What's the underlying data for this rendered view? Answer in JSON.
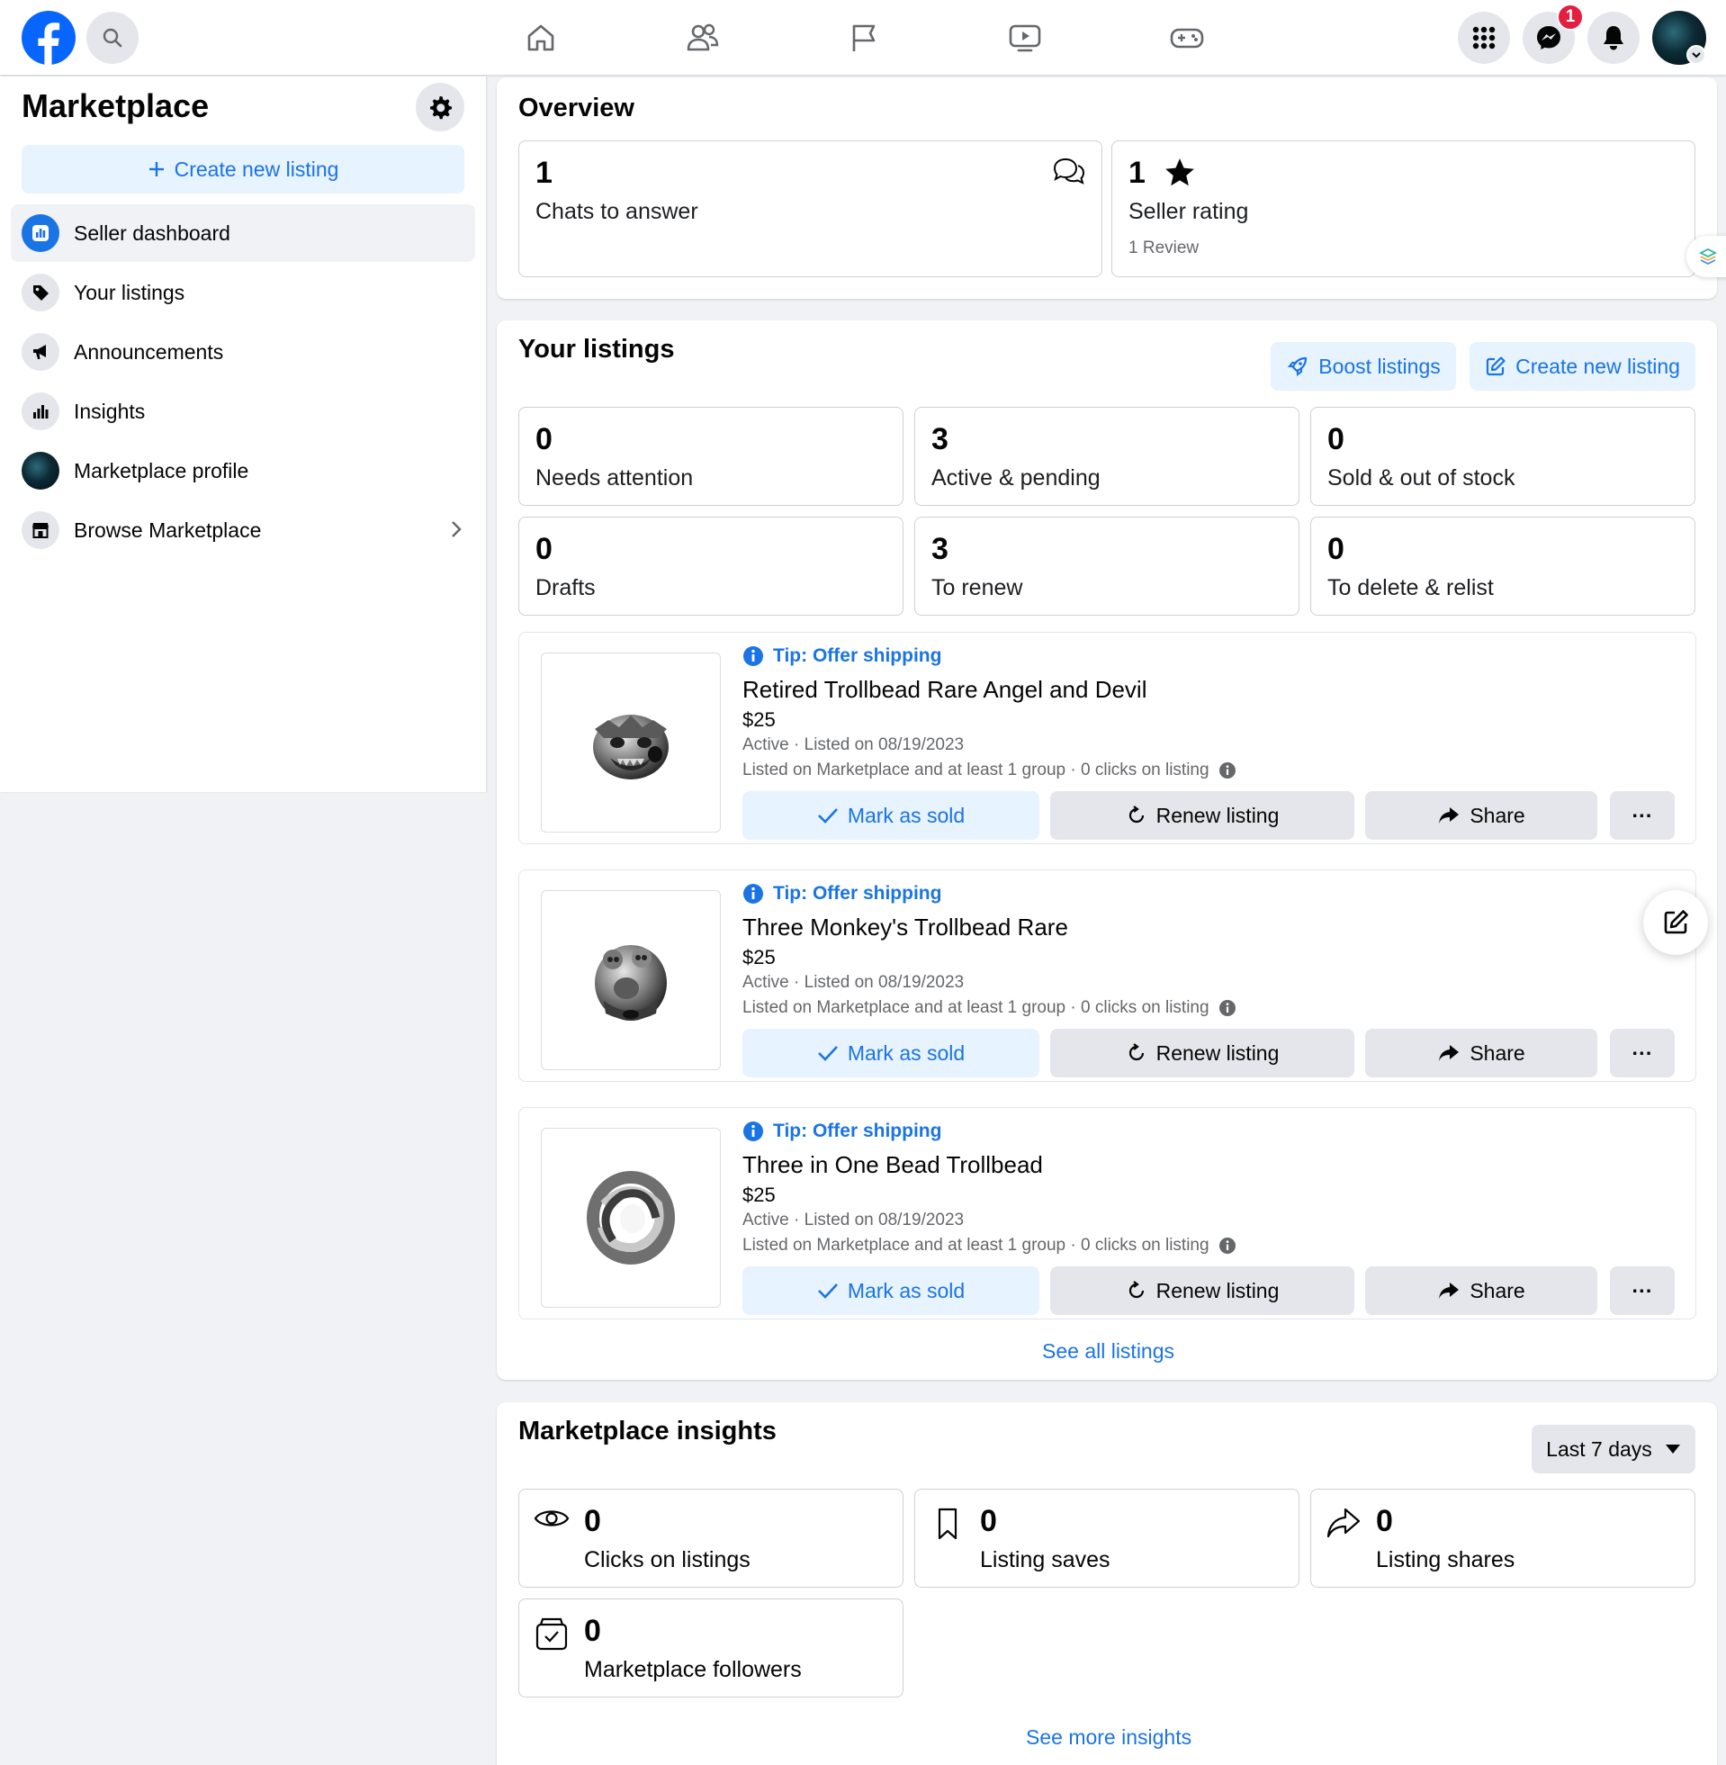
{
  "header": {
    "messenger_badge": "1",
    "icons": [
      "facebook-logo",
      "search-icon",
      "home-icon",
      "friends-icon",
      "pages-flag-icon",
      "watch-icon",
      "gaming-icon",
      "menu-grid-icon",
      "messenger-icon",
      "notifications-bell-icon",
      "profile-avatar"
    ]
  },
  "sidebar": {
    "title": "Marketplace",
    "create_label": "Create new listing",
    "items": [
      {
        "label": "Seller dashboard"
      },
      {
        "label": "Your listings"
      },
      {
        "label": "Announcements"
      },
      {
        "label": "Insights"
      },
      {
        "label": "Marketplace profile"
      },
      {
        "label": "Browse Marketplace"
      }
    ]
  },
  "overview": {
    "title": "Overview",
    "chats": {
      "value": "1",
      "label": "Chats to answer"
    },
    "rating": {
      "value": "1",
      "label": "Seller rating",
      "sub": "1 Review"
    }
  },
  "your_listings": {
    "title": "Your listings",
    "boost_label": "Boost listings",
    "create_label": "Create new listing",
    "stats": [
      {
        "value": "0",
        "label": "Needs attention"
      },
      {
        "value": "3",
        "label": "Active & pending"
      },
      {
        "value": "0",
        "label": "Sold & out of stock"
      },
      {
        "value": "0",
        "label": "Drafts"
      },
      {
        "value": "3",
        "label": "To renew"
      },
      {
        "value": "0",
        "label": "To delete & relist"
      }
    ],
    "items": [
      {
        "tip": "Tip: Offer shipping",
        "title": "Retired Trollbead Rare Angel and Devil",
        "price": "$25",
        "status": "Active · Listed on 08/19/2023",
        "detail": "Listed on Marketplace and at least 1 group · 0 clicks on listing"
      },
      {
        "tip": "Tip: Offer shipping",
        "title": "Three Monkey's Trollbead Rare",
        "price": "$25",
        "status": "Active · Listed on 08/19/2023",
        "detail": "Listed on Marketplace and at least 1 group · 0 clicks on listing"
      },
      {
        "tip": "Tip: Offer shipping",
        "title": "Three in One Bead Trollbead",
        "price": "$25",
        "status": "Active · Listed on 08/19/2023",
        "detail": "Listed on Marketplace and at least 1 group · 0 clicks on listing"
      }
    ],
    "buttons": {
      "sold": "Mark as sold",
      "renew": "Renew listing",
      "share": "Share",
      "more": "···"
    },
    "see_all": "See all listings"
  },
  "insights": {
    "title": "Marketplace insights",
    "range": "Last 7 days",
    "stats": [
      {
        "value": "0",
        "label": "Clicks on listings",
        "icon": "eye-icon"
      },
      {
        "value": "0",
        "label": "Listing saves",
        "icon": "bookmark-icon"
      },
      {
        "value": "0",
        "label": "Listing shares",
        "icon": "share-icon"
      },
      {
        "value": "0",
        "label": "Marketplace followers",
        "icon": "followers-icon"
      }
    ],
    "see_more": "See more insights"
  },
  "colors": {
    "accent": "#1b74e4",
    "background": "#f0f2f5",
    "badge": "#e41e3f"
  }
}
